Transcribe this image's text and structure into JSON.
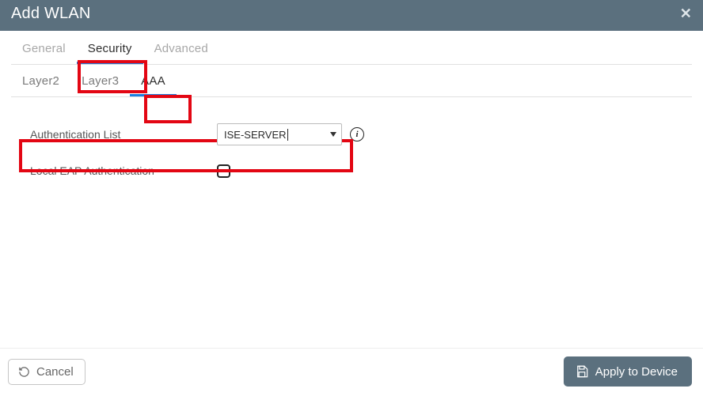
{
  "titlebar": {
    "title": "Add WLAN"
  },
  "tabs": {
    "main": {
      "general": "General",
      "security": "Security",
      "advanced": "Advanced"
    },
    "sub": {
      "layer2": "Layer2",
      "layer3": "Layer3",
      "aaa": "AAA"
    }
  },
  "form": {
    "auth_list_label": "Authentication List",
    "auth_list_value": "ISE-SERVER",
    "local_eap_label": "Local EAP Authentication"
  },
  "footer": {
    "cancel": "Cancel",
    "apply": "Apply to Device"
  }
}
